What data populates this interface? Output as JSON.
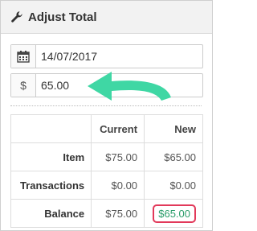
{
  "header": {
    "title": "Adjust Total",
    "icon": "wrench-icon"
  },
  "date_field": {
    "icon": "calendar-icon",
    "value": "14/07/2017"
  },
  "amount_field": {
    "prefix": "$",
    "value": "65.00"
  },
  "table": {
    "columns": [
      "",
      "Current",
      "New"
    ],
    "rows": [
      {
        "label": "Item",
        "current": "$75.00",
        "new": "$65.00"
      },
      {
        "label": "Transactions",
        "current": "$0.00",
        "new": "$0.00"
      },
      {
        "label": "Balance",
        "current": "$75.00",
        "new": "$65.00"
      }
    ]
  },
  "colors": {
    "arrow": "#3fd7a4",
    "highlight_border": "#e2395a",
    "highlight_text": "#2a9d6a"
  }
}
